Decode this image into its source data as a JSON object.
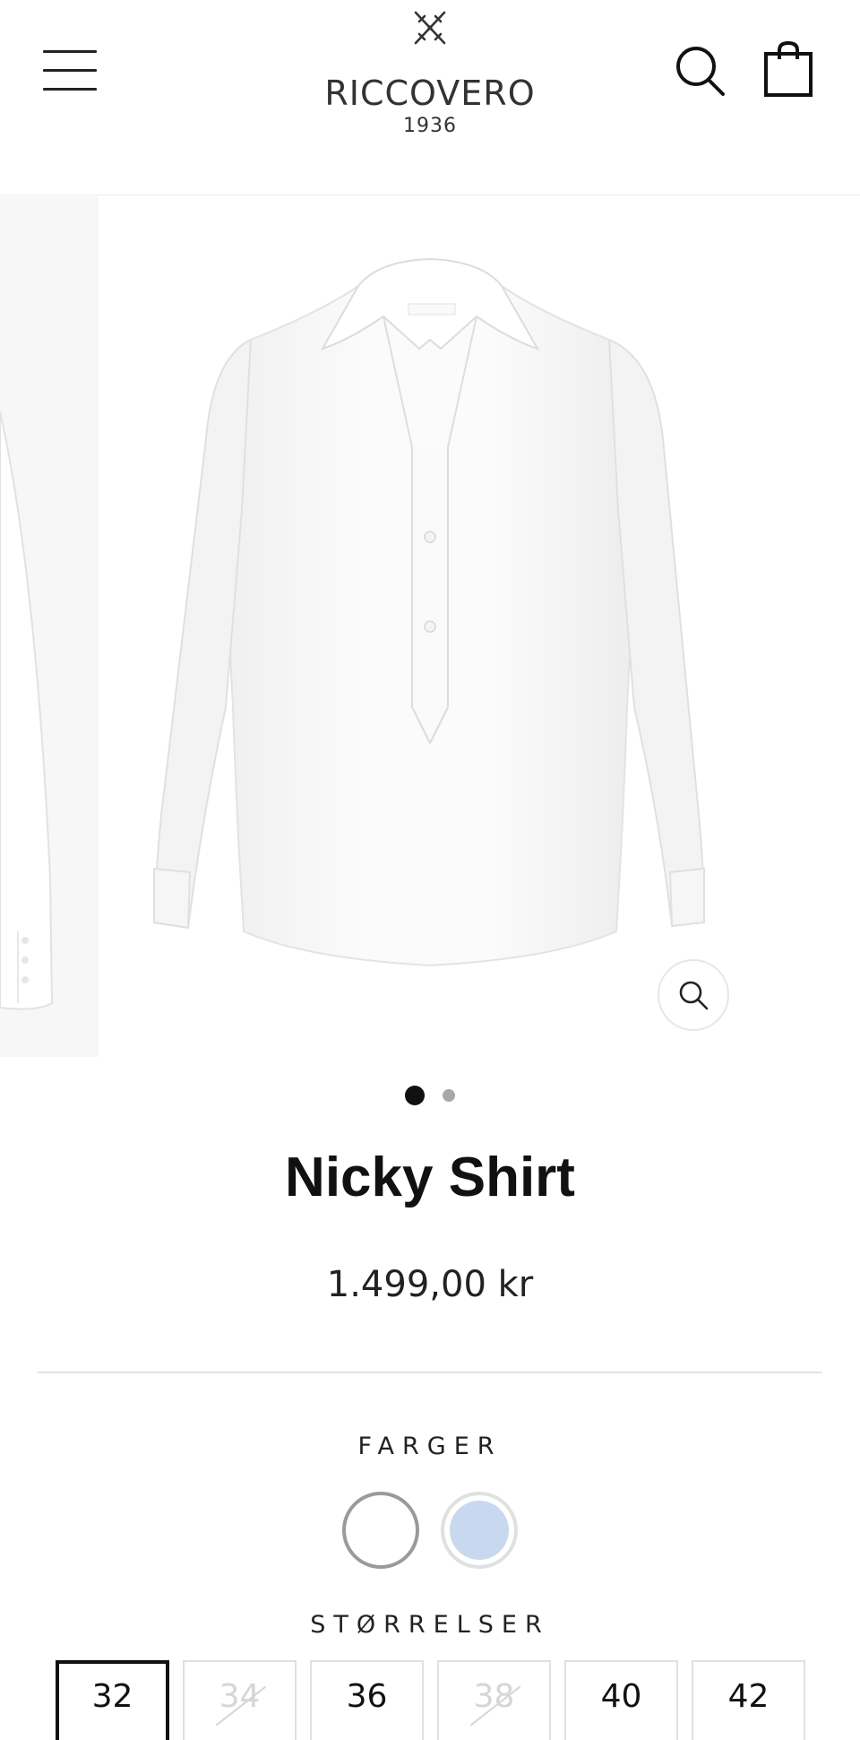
{
  "header": {
    "brand_name": "RICCOVERO",
    "brand_year": "1936",
    "menu_icon": "hamburger-menu-icon",
    "search_icon": "search-icon",
    "cart_icon": "shopping-bag-icon"
  },
  "gallery": {
    "slide_count": 2,
    "active_slide": 1,
    "zoom_icon": "zoom-icon",
    "image_subject": "white long-sleeve shirt"
  },
  "product": {
    "title": "Nicky Shirt",
    "price": "1.499,00 kr"
  },
  "colors": {
    "label": "FARGER",
    "options": [
      {
        "name": "white",
        "hex": "#ffffff",
        "selected": true
      },
      {
        "name": "light blue",
        "hex": "#c8d8ee",
        "selected": false
      }
    ]
  },
  "sizes": {
    "label": "STØRRELSER",
    "options": [
      {
        "label": "32",
        "available": true,
        "selected": true
      },
      {
        "label": "34",
        "available": false,
        "selected": false
      },
      {
        "label": "36",
        "available": true,
        "selected": false
      },
      {
        "label": "38",
        "available": false,
        "selected": false
      },
      {
        "label": "40",
        "available": true,
        "selected": false
      },
      {
        "label": "42",
        "available": true,
        "selected": false
      }
    ]
  }
}
